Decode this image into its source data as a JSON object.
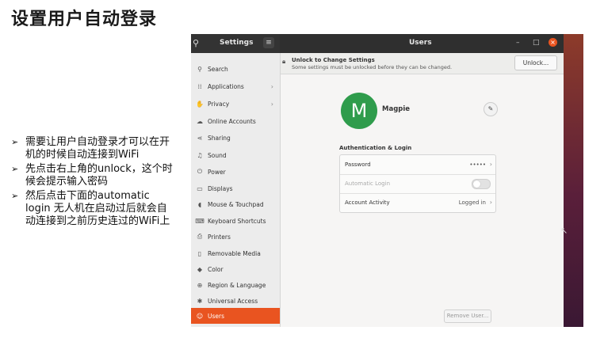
{
  "slide": {
    "title": "设置用户自动登录",
    "bullets": [
      "需要让用户自动登录才可以在开机的时候自动连接到WiFi",
      "先点击右上角的unlock，这个时候会提示输入密码",
      "然后点击下面的automatic login 无人机在启动过后就会自动连接到之前历史连过的WiFi上"
    ]
  },
  "window": {
    "sidebar_title": "Settings",
    "panel_title": "Users",
    "menu_icon": "hamburger-icon",
    "search_icon": "search-icon"
  },
  "sidebar": {
    "items": [
      {
        "label": "Search",
        "icon": "search-icon"
      },
      {
        "label": "Applications",
        "icon": "grid-icon",
        "chevron": "›"
      },
      {
        "label": "Privacy",
        "icon": "hand-icon",
        "chevron": "›"
      },
      {
        "label": "Online Accounts",
        "icon": "cloud-icon"
      },
      {
        "label": "Sharing",
        "icon": "share-icon"
      },
      {
        "label": "Sound",
        "icon": "music-note-icon"
      },
      {
        "label": "Power",
        "icon": "power-icon"
      },
      {
        "label": "Displays",
        "icon": "monitor-icon"
      },
      {
        "label": "Mouse & Touchpad",
        "icon": "mouse-icon"
      },
      {
        "label": "Keyboard Shortcuts",
        "icon": "keyboard-icon"
      },
      {
        "label": "Printers",
        "icon": "printer-icon"
      },
      {
        "label": "Removable Media",
        "icon": "media-icon"
      },
      {
        "label": "Color",
        "icon": "color-icon"
      },
      {
        "label": "Region & Language",
        "icon": "globe-icon"
      },
      {
        "label": "Universal Access",
        "icon": "accessibility-icon"
      },
      {
        "label": "Users",
        "icon": "users-icon",
        "active": true
      }
    ]
  },
  "lockbar": {
    "title": "Unlock to Change Settings",
    "subtitle": "Some settings must be unlocked before they can be changed.",
    "unlock_label": "Unlock..."
  },
  "user": {
    "initial": "M",
    "name": "Magpie",
    "avatar_color": "#2f9c4c"
  },
  "auth": {
    "heading": "Authentication & Login",
    "password_label": "Password",
    "password_value": "•••••",
    "autologin_label": "Automatic Login",
    "autologin_on": false,
    "activity_label": "Account Activity",
    "activity_value": "Logged in"
  },
  "remove_label": "Remove User...",
  "colors": {
    "accent": "#e95420",
    "headerbar": "#2f2f2f"
  }
}
